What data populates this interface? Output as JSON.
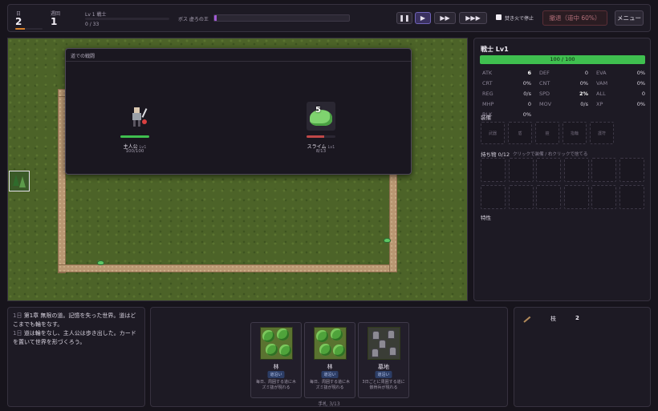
{
  "topbar": {
    "day_label": "日",
    "day_value": "2",
    "day_progress": 0.35,
    "loop_label": "週回",
    "loop_value": "1",
    "level_label": "Lv 1 戦士",
    "xp_text": "0 / 33",
    "boss_label": "ボス 虚ろの王",
    "boss_progress": 0.01,
    "stop_at_campfire_label": "焚き火で停止",
    "retreat_label": "撤退（道中 60%）",
    "menu_label": "メニュー",
    "speed_buttons": [
      "pause",
      "play",
      "fast",
      "fastest"
    ]
  },
  "battle": {
    "title": "道での戦闘",
    "hero": {
      "name": "主人公",
      "level": "Lv1",
      "hp_text": "100/100",
      "hp_fraction": 1.0
    },
    "enemy": {
      "name": "スライム",
      "level": "Lv1",
      "hp_text": "8/13",
      "hp_fraction": 0.62,
      "damage_popup": "5"
    }
  },
  "hero_panel": {
    "title": "戦士 Lv1",
    "hp_text": "100 / 100",
    "hp_fraction": 1.0,
    "stats": [
      {
        "k": "ATK",
        "v": "6",
        "hl": true
      },
      {
        "k": "DEF",
        "v": "0"
      },
      {
        "k": "EVA",
        "v": "0%"
      },
      {
        "k": "CRT",
        "v": "0%"
      },
      {
        "k": "CNT",
        "v": "0%"
      },
      {
        "k": "VAM",
        "v": "0%"
      },
      {
        "k": "REG",
        "v": "0/s"
      },
      {
        "k": "SPD",
        "v": "2%",
        "hl": true
      },
      {
        "k": "ALL",
        "v": "0"
      },
      {
        "k": "MHP",
        "v": "0"
      },
      {
        "k": "MOV",
        "v": "0/s"
      },
      {
        "k": "XP",
        "v": "0%"
      },
      {
        "k": "BLK",
        "v": "0%"
      }
    ],
    "equipment_label": "装備",
    "equipment_slots": [
      "武器",
      "盾",
      "鎧",
      "指輪",
      "護符"
    ],
    "inventory_label": "持ち物 0/12",
    "inventory_hint": "クリックで装備 / 右クリックで捨てる",
    "traits_label": "特性"
  },
  "log": {
    "lines": [
      {
        "day": "1日",
        "text": "第1章 無限の道。記憶を失った世界。道はどこまでも輪をなす。"
      },
      {
        "day": "1日",
        "text": "道は輪をなし、主人公は歩き出した。カードを置いて世界を形づくろう。"
      }
    ]
  },
  "hand": {
    "cards": [
      {
        "name": "林",
        "tag": "道沿い",
        "desc": "毎日、周囲する道に木ズミ抜が現れる",
        "art": "forest"
      },
      {
        "name": "林",
        "tag": "道沿い",
        "desc": "毎日、周囲する道に木ズミ抜が現れる",
        "art": "forest"
      },
      {
        "name": "墓地",
        "tag": "道沿い",
        "desc": "3日ごとに周囲する道に骸骨兵が現れる",
        "art": "cemetery"
      }
    ],
    "count_text": "手札 3/13"
  },
  "resources": {
    "items": [
      {
        "icon": "branch-icon",
        "name": "枝",
        "value": "2"
      }
    ]
  },
  "colors": {
    "hp_green": "#3fbf4f",
    "enemy_red": "#c04848",
    "boss_purple": "#a25ad6",
    "day_orange": "#d9822b"
  }
}
